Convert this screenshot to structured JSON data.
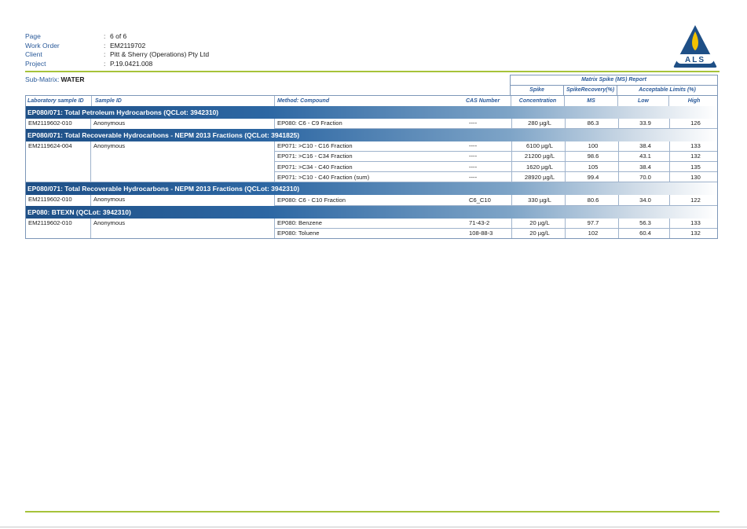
{
  "header": {
    "fields": [
      {
        "label": "Page",
        "value": "6 of 6"
      },
      {
        "label": "Work Order",
        "value": "EM2119702"
      },
      {
        "label": "Client",
        "value": "Pitt & Sherry (Operations) Pty Ltd"
      },
      {
        "label": "Project",
        "value": "P.19.0421.008"
      }
    ],
    "logo_text": "ALS",
    "colon": ":"
  },
  "submatrix": {
    "label": "Sub-Matrix:",
    "value": "WATER"
  },
  "table": {
    "super_header": "Matrix Spike (MS) Report",
    "col_headers": {
      "spike": "Spike",
      "spike_recovery": "SpikeRecovery(%)",
      "acceptable_limits": "Acceptable Limits (%)",
      "lab_sample_id": "Laboratory sample ID",
      "sample_id": "Sample ID",
      "method": "Method: Compound",
      "cas": "CAS Number",
      "concentration": "Concentration",
      "ms": "MS",
      "low": "Low",
      "high": "High"
    },
    "groups": [
      {
        "title": "EP080/071: Total Petroleum Hydrocarbons  (QCLot: 3942310)",
        "lab_id": "EM2119602-010",
        "sample_id": "Anonymous",
        "rows": [
          {
            "method": "EP080: C6 - C9 Fraction",
            "cas": "----",
            "conc": "280 µg/L",
            "ms": "86.3",
            "low": "33.9",
            "high": "126"
          }
        ]
      },
      {
        "title": "EP080/071: Total Recoverable Hydrocarbons - NEPM 2013 Fractions  (QCLot: 3941825)",
        "lab_id": "EM2119624-004",
        "sample_id": "Anonymous",
        "rows": [
          {
            "method": "EP071: >C10 - C16 Fraction",
            "cas": "----",
            "conc": "6100 µg/L",
            "ms": "100",
            "low": "38.4",
            "high": "133"
          },
          {
            "method": "EP071: >C16 - C34 Fraction",
            "cas": "----",
            "conc": "21200 µg/L",
            "ms": "98.6",
            "low": "43.1",
            "high": "132"
          },
          {
            "method": "EP071: >C34 - C40 Fraction",
            "cas": "----",
            "conc": "1620 µg/L",
            "ms": "105",
            "low": "38.4",
            "high": "135"
          },
          {
            "method": "EP071: >C10 - C40 Fraction (sum)",
            "cas": "----",
            "conc": "28920 µg/L",
            "ms": "99.4",
            "low": "70.0",
            "high": "130"
          }
        ]
      },
      {
        "title": "EP080/071: Total Recoverable Hydrocarbons - NEPM 2013 Fractions  (QCLot: 3942310)",
        "lab_id": "EM2119602-010",
        "sample_id": "Anonymous",
        "rows": [
          {
            "method": "EP080: C6 - C10 Fraction",
            "cas": "C6_C10",
            "conc": "330 µg/L",
            "ms": "80.6",
            "low": "34.0",
            "high": "122"
          }
        ]
      },
      {
        "title": "EP080: BTEXN  (QCLot: 3942310)",
        "lab_id": "EM2119602-010",
        "sample_id": "Anonymous",
        "rows": [
          {
            "method": "EP080: Benzene",
            "cas": "71-43-2",
            "conc": "20 µg/L",
            "ms": "97.7",
            "low": "56.3",
            "high": "133"
          },
          {
            "method": "EP080: Toluene",
            "cas": "108-88-3",
            "conc": "20 µg/L",
            "ms": "102",
            "low": "60.4",
            "high": "132"
          }
        ]
      }
    ]
  },
  "colors": {
    "accent_green": "#a6c33a",
    "brand_blue": "#1e4f86",
    "label_blue": "#2a5a9a",
    "logo_yellow": "#f2c200"
  }
}
